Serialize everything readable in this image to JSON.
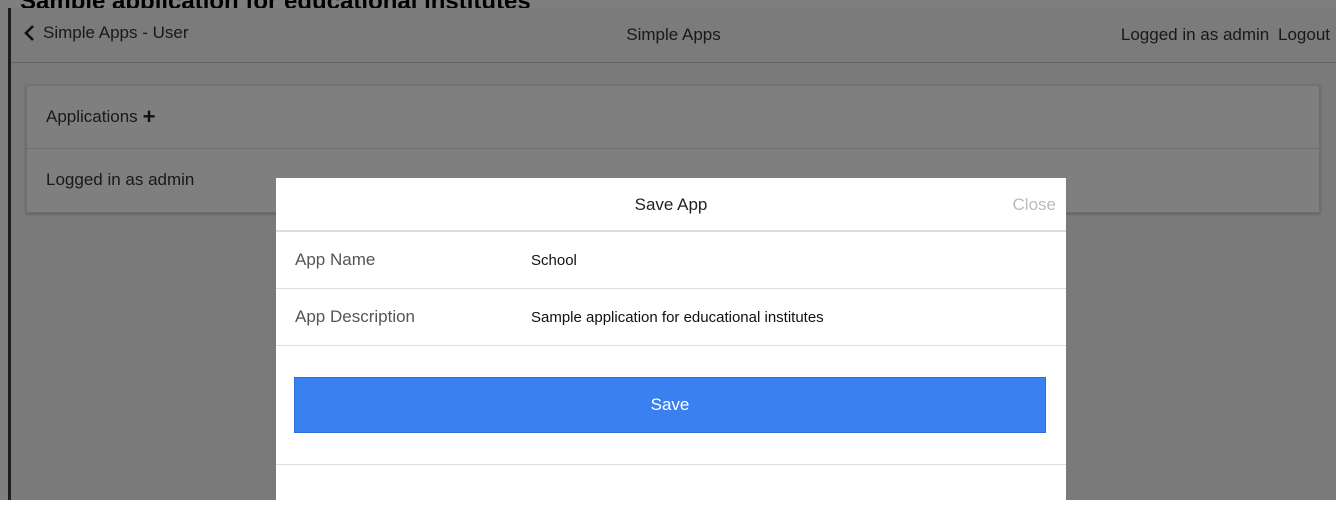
{
  "page_heading": "Sample application for educational institutes",
  "navbar": {
    "back_label": "Simple Apps - User",
    "title": "Simple Apps",
    "logged_in_label": "Logged in as admin",
    "logout_label": "Logout"
  },
  "card": {
    "applications_label": "Applications",
    "plus_symbol": "+",
    "logged_in_text": "Logged in as admin"
  },
  "modal": {
    "title": "Save App",
    "close_label": "Close",
    "fields": [
      {
        "label": "App Name",
        "value": "School"
      },
      {
        "label": "App Description",
        "value": "Sample application for educational institutes"
      }
    ],
    "save_label": "Save"
  }
}
